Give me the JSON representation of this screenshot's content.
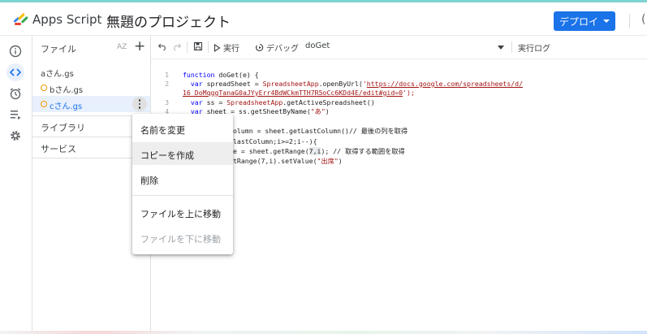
{
  "header": {
    "app_name": "Apps Script",
    "project_name": "無題のプロジェクト",
    "deploy_label": "デプロイ",
    "trailing_char": "("
  },
  "rail": {
    "items": [
      {
        "icon": "info-icon"
      },
      {
        "icon": "code-icon",
        "active": true
      },
      {
        "icon": "alarm-icon"
      },
      {
        "icon": "executions-icon"
      },
      {
        "icon": "gear-icon"
      }
    ]
  },
  "files_panel": {
    "title": "ファイル",
    "sort_label": "AZ",
    "add_label": "+",
    "files": [
      {
        "name": "aさん.gs",
        "unsaved": false
      },
      {
        "name": "bさん.gs",
        "unsaved": true
      },
      {
        "name": "cさん.gs",
        "unsaved": true,
        "selected": true
      }
    ],
    "libraries_label": "ライブラリ",
    "services_label": "サービス"
  },
  "toolbar": {
    "run_label": "実行",
    "debug_label": "デバッグ",
    "function_name": "doGet",
    "log_label": "実行ログ"
  },
  "editor": {
    "line_numbers": [
      "1",
      "2",
      "3",
      "4"
    ],
    "lines": {
      "l1_kw": "function",
      "l1_rest": " doGet(e) {",
      "l2_var": "  var",
      "l2_mid": " spreadSheet = ",
      "l2_cls": "SpreadsheetApp",
      "l2_call": ".openByUrl(",
      "l2_q1": "'",
      "l2_url1": "https://docs.google.com/spreadsheets/d/",
      "l2_url2": "16_DoMqggTanaG0aJYyErr4BdWCkmTTH7R5oCc6KDd4E/edit#gid=0",
      "l2_end": "');",
      "l3_var": "  var",
      "l3_mid": " ss = ",
      "l3_cls": "SpreadsheetApp",
      "l3_end": ".getActiveSpreadsheet()",
      "l4_var": "  var",
      "l4_mid": " sheet = ss.getSheetByName(",
      "l4_str": "\"あ\"",
      "l4_end": ")",
      "l5": "olumn = sheet.getLastColumn()// 最後の列を取得",
      "l6": "lastColumn;i>=2;i--){",
      "l7a": "e = sheet.getRange(",
      "l7b": "7,i",
      "l7c": "); // 取得する範囲を取得",
      "l8a": "tRange(7,i).setValue(",
      "l8b": "\"出席\"",
      "l8c": ")"
    }
  },
  "context_menu": {
    "items": [
      {
        "label": "名前を変更",
        "enabled": true
      },
      {
        "label": "コピーを作成",
        "enabled": true,
        "hovered": true
      },
      {
        "label": "削除",
        "enabled": true
      },
      {
        "label": "ファイルを上に移動",
        "enabled": true
      },
      {
        "label": "ファイルを下に移動",
        "enabled": false
      }
    ]
  },
  "colors": {
    "accent": "#1a73e8",
    "unsaved_dot": "#f29900",
    "selected_bg": "#e8f0fe"
  }
}
